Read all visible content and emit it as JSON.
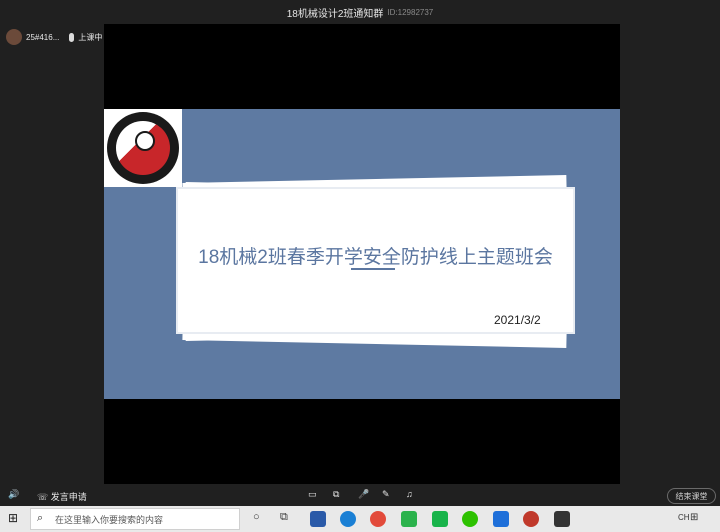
{
  "window": {
    "title": "18机械设计2班通知群",
    "room_id": "ID:12982737"
  },
  "user": {
    "name": "25#416...",
    "status": "上课中"
  },
  "slide": {
    "headline": "18机械2班春季开学安全防护线上主题班会",
    "date": "2021/3/2"
  },
  "controls": {
    "apply_speak": "发言申请",
    "end_class": "结束课堂"
  },
  "taskbar": {
    "search_placeholder": "在这里输入你要搜索的内容",
    "tray_lang": "CH"
  }
}
